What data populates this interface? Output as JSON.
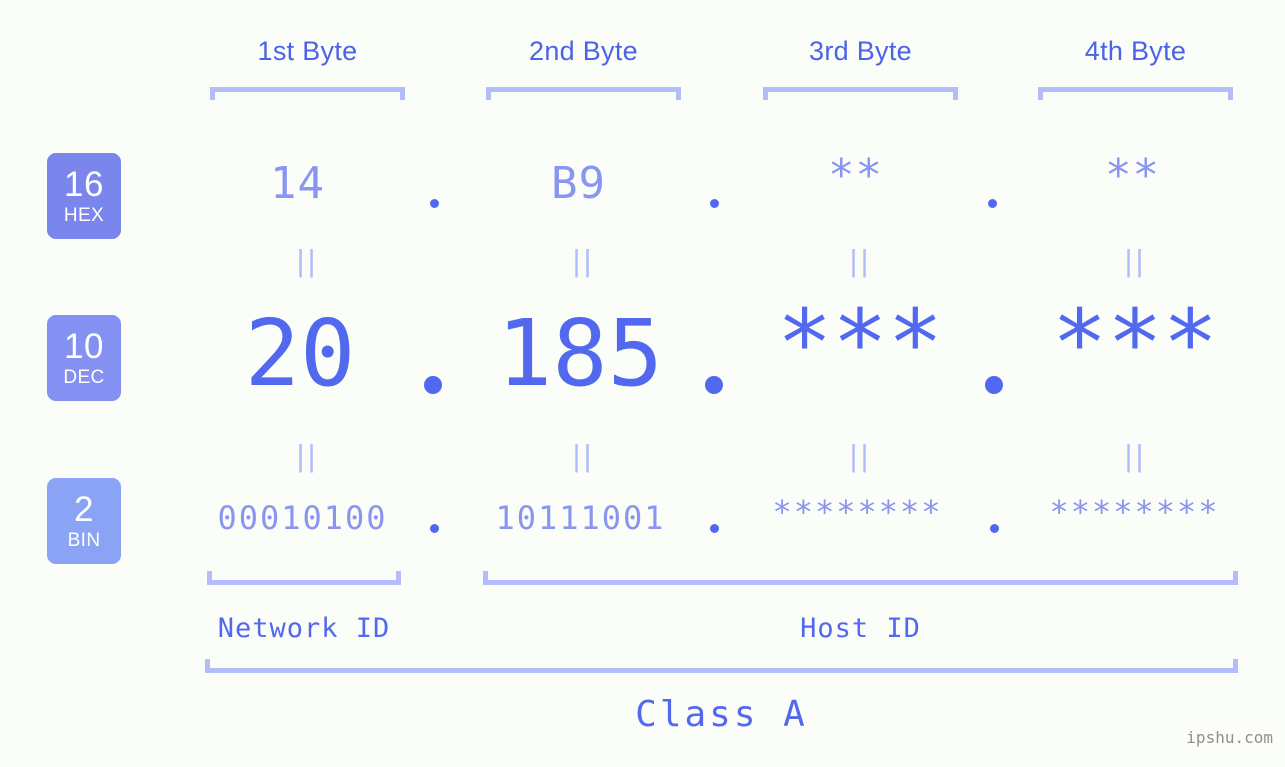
{
  "bytes": {
    "headers": [
      {
        "label": "1st Byte"
      },
      {
        "label": "2nd Byte"
      },
      {
        "label": "3rd Byte"
      },
      {
        "label": "4th Byte"
      }
    ]
  },
  "bases": [
    {
      "number": "16",
      "name": "HEX",
      "color": "#7b86ed"
    },
    {
      "number": "10",
      "name": "DEC",
      "color": "#8591f2"
    },
    {
      "number": "2",
      "name": "BIN",
      "color": "#8ba3f5"
    }
  ],
  "rows": {
    "hex": {
      "base_number": "16",
      "base_name": "HEX",
      "values": [
        "14",
        "B9",
        "**",
        "**"
      ],
      "separator": "."
    },
    "dec": {
      "base_number": "10",
      "base_name": "DEC",
      "values": [
        "20",
        "185",
        "***",
        "***"
      ],
      "separator": "."
    },
    "bin": {
      "base_number": "2",
      "base_name": "BIN",
      "values": [
        "00010100",
        "10111001",
        "********",
        "********"
      ],
      "separator": "."
    }
  },
  "equals_marks": [
    "||",
    "||",
    "||",
    "||",
    "||",
    "||",
    "||",
    "||"
  ],
  "segments": {
    "network_id": "Network ID",
    "host_id": "Host ID",
    "class": "Class A"
  },
  "watermark": "ipshu.com",
  "colors": {
    "background": "#fbfdf8",
    "accent_dark": "#4c62e8",
    "accent": "#5269ef",
    "accent_light": "#8a95f2",
    "bracket": "#b3bdfb",
    "watermark": "#8f8f8f"
  }
}
